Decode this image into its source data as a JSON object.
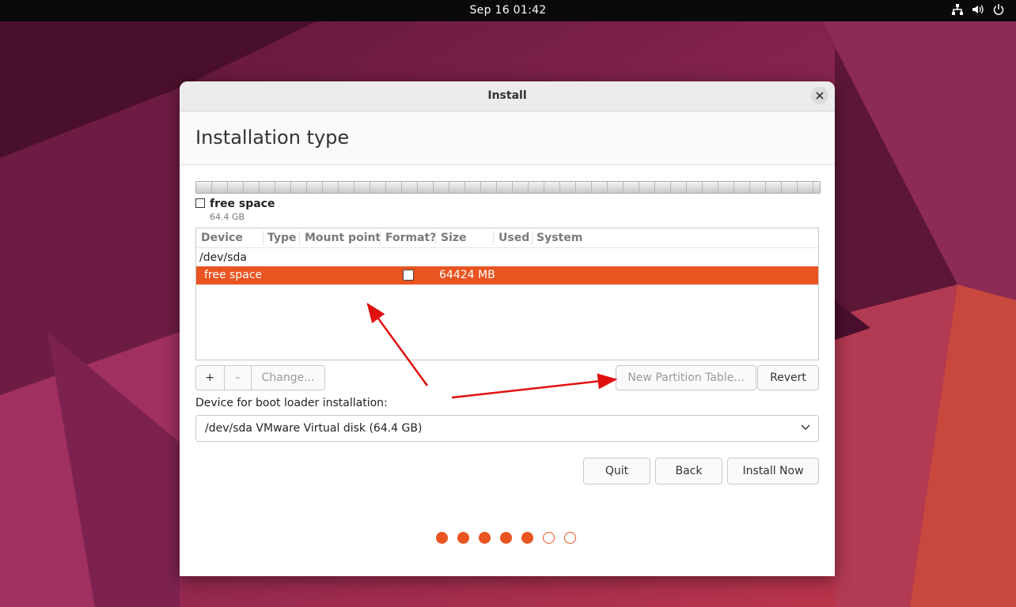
{
  "topbar": {
    "clock": "Sep 16  01:42",
    "icons": [
      "network-icon",
      "volume-icon",
      "power-icon"
    ]
  },
  "window": {
    "title": "Install",
    "close_icon": "close-icon"
  },
  "page": {
    "title": "Installation type"
  },
  "partition_bar": {
    "legend_label": "free space",
    "legend_size": "64.4 GB"
  },
  "table": {
    "columns": [
      "Device",
      "Type",
      "Mount point",
      "Format?",
      "Size",
      "Used",
      "System"
    ],
    "group": "/dev/sda",
    "rows": [
      {
        "device": "free space",
        "type": "",
        "mount": "",
        "format": false,
        "size": "64424 MB",
        "used": "",
        "system": ""
      }
    ]
  },
  "buttons": {
    "add": "+",
    "remove": "–",
    "change": "Change...",
    "new_partition_table": "New Partition Table...",
    "revert": "Revert",
    "quit": "Quit",
    "back": "Back",
    "install_now": "Install Now"
  },
  "bootloader": {
    "label": "Device for boot loader installation:",
    "selected": "/dev/sda VMware Virtual disk (64.4 GB)"
  },
  "progress": {
    "completed_steps": 5,
    "total_steps": 7
  },
  "colors": {
    "accent": "#e95420",
    "annotation_arrow": "#e01010"
  }
}
